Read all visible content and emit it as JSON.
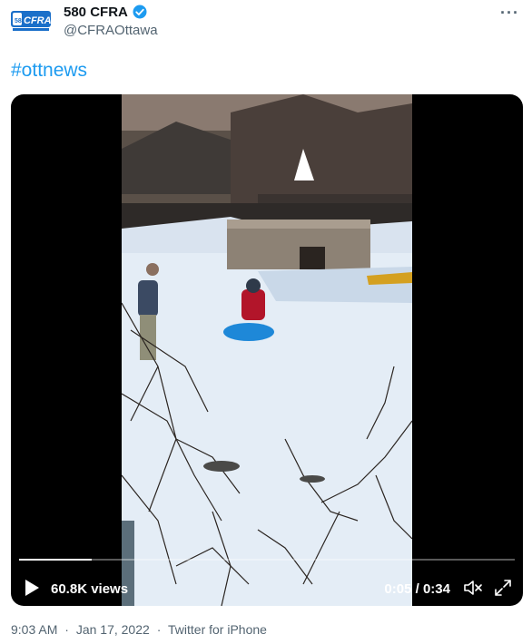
{
  "account": {
    "display_name": "580 CFRA",
    "handle": "@CFRAOttawa",
    "verified": true,
    "avatar_logo_text": "580 CFRA NEWS TALK RADIO",
    "avatar_color": "#1a6fc9"
  },
  "tweet": {
    "text": "#ottnews"
  },
  "video": {
    "views": "60.8K views",
    "current_time": "0:05",
    "separator": "/",
    "duration": "0:34",
    "progress": 0.147,
    "state": "paused"
  },
  "meta": {
    "time": "9:03 AM",
    "dot1": "·",
    "date": "Jan 17, 2022",
    "dot2": "·",
    "source": "Twitter for iPhone"
  },
  "colors": {
    "link": "#1d9bf0",
    "secondary_text": "#536471",
    "primary_text": "#0f1419",
    "verified_badge": "#1d9bf0"
  },
  "icons": [
    "more-options-icon",
    "verified-badge-icon",
    "play-icon",
    "mute-icon",
    "fullscreen-icon"
  ]
}
